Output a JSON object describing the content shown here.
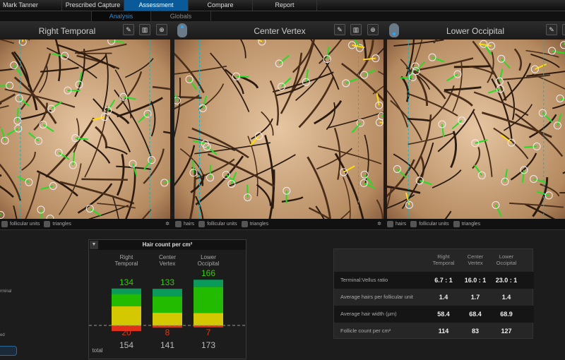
{
  "nav": {
    "tabs": [
      {
        "label": "Mark Tanner"
      },
      {
        "label": "Prescribed Capture"
      },
      {
        "label": "Assessment",
        "active": true
      },
      {
        "label": "Compare"
      },
      {
        "label": "Report"
      }
    ]
  },
  "subnav": {
    "tabs": [
      {
        "label": "Analysis",
        "active": true
      },
      {
        "label": "Globals"
      }
    ]
  },
  "panels": [
    {
      "title": "Right Temporal",
      "footer": [
        "follicular units",
        "triangles"
      ]
    },
    {
      "title": "Center Vertex",
      "footer": [
        "hairs",
        "follicular units",
        "triangles"
      ]
    },
    {
      "title": "Lower Occipital",
      "footer": [
        "hairs",
        "follicular units",
        "triangles"
      ]
    }
  ],
  "left_partial": {
    "a": "rminal",
    "b": "ed"
  },
  "chart_data": {
    "type": "bar",
    "title": "Hair count per cm²",
    "categories": [
      "Right Temporal",
      "Center Vertex",
      "Lower Occipital"
    ],
    "cat_lines": [
      [
        "Right",
        "Temporal"
      ],
      [
        "Center",
        "Vertex"
      ],
      [
        "Lower",
        "Occipital"
      ]
    ],
    "terminal_totals": [
      134,
      133,
      166
    ],
    "vellus": [
      20,
      8,
      7
    ],
    "totals": [
      154,
      141,
      173
    ],
    "total_label": "total",
    "series": [
      {
        "name": "dark green",
        "color": "#0a9a5a",
        "values": [
          20,
          28,
          26
        ]
      },
      {
        "name": "green",
        "color": "#22bb00",
        "values": [
          44,
          59,
          95
        ]
      },
      {
        "name": "yellow",
        "color": "#d4c800",
        "values": [
          70,
          46,
          45
        ]
      },
      {
        "name": "red",
        "color": "#e0301a",
        "values": [
          20,
          8,
          7
        ]
      }
    ]
  },
  "metrics": {
    "columns": [
      [
        "Right",
        "Temporal"
      ],
      [
        "Center",
        "Vertex"
      ],
      [
        "Lower",
        "Occipital"
      ]
    ],
    "rows": [
      {
        "label": "Terminal:Vellus ratio",
        "values": [
          "6.7 : 1",
          "16.0 : 1",
          "23.0 : 1"
        ]
      },
      {
        "label": "Average hairs per follicular unit",
        "values": [
          "1.4",
          "1.7",
          "1.4"
        ]
      },
      {
        "label": "Average hair width (μm)",
        "values": [
          "58.4",
          "68.4",
          "68.9"
        ]
      },
      {
        "label": "Follicle count per cm²",
        "values": [
          "114",
          "83",
          "127"
        ]
      }
    ]
  }
}
